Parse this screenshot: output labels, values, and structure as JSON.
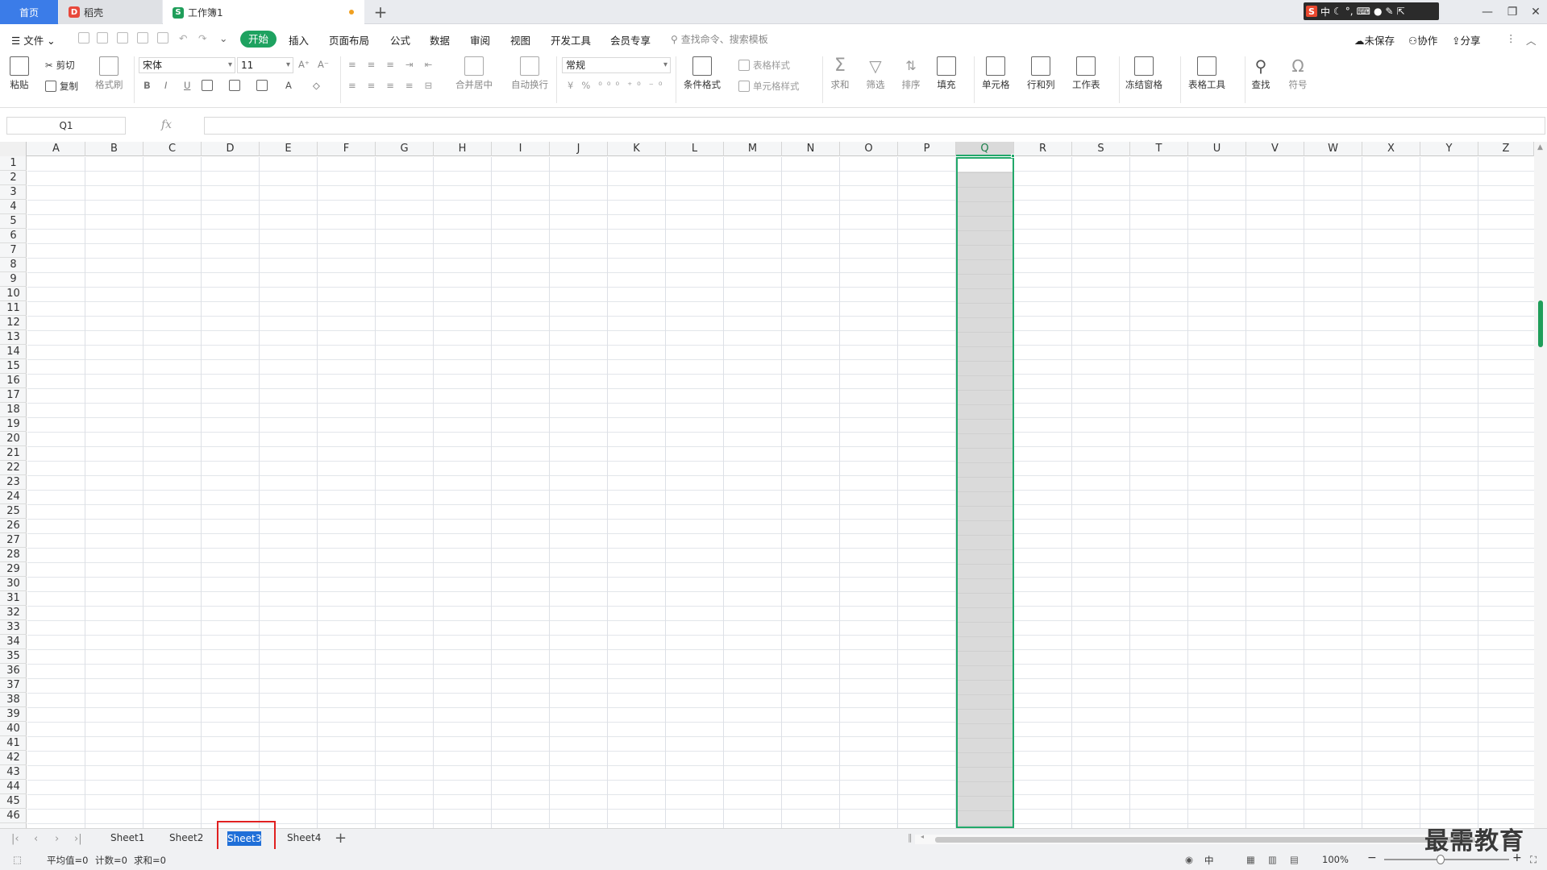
{
  "tabs": {
    "home": "首页",
    "daoke": "稻壳",
    "workbook": "工作簿1",
    "new_tab": "+"
  },
  "ime": {
    "label": "中"
  },
  "window": {
    "minimize": "—",
    "restore": "❐",
    "close": "✕"
  },
  "menu": {
    "file": "文件",
    "items": [
      "开始",
      "插入",
      "页面布局",
      "公式",
      "数据",
      "审阅",
      "视图",
      "开发工具",
      "会员专享"
    ],
    "search_placeholder": "查找命令、搜索模板",
    "unsaved": "未保存",
    "collab": "协作",
    "share": "分享"
  },
  "ribbon": {
    "paste": "粘贴",
    "cut": "剪切",
    "copy": "复制",
    "format_painter": "格式刷",
    "font_name": "宋体",
    "font_size": "11",
    "merge_center": "合并居中",
    "auto_wrap": "自动换行",
    "number_format": "常规",
    "cond_format": "条件格式",
    "table_style": "表格样式",
    "cell_style": "单元格样式",
    "sum": "求和",
    "filter": "筛选",
    "sort": "排序",
    "fill": "填充",
    "cell": "单元格",
    "row_col": "行和列",
    "worksheet": "工作表",
    "freeze": "冻结窗格",
    "table_tools": "表格工具",
    "find": "查找",
    "symbol": "符号"
  },
  "formula": {
    "name_box": "Q1",
    "fx": "fx",
    "value": ""
  },
  "grid": {
    "columns": [
      "A",
      "B",
      "C",
      "D",
      "E",
      "F",
      "G",
      "H",
      "I",
      "J",
      "K",
      "L",
      "M",
      "N",
      "O",
      "P",
      "Q",
      "R",
      "S",
      "T",
      "U",
      "V",
      "W",
      "X",
      "Y",
      "Z"
    ],
    "selected_column": "Q",
    "rows": [
      "1",
      "2",
      "3",
      "4",
      "5",
      "6",
      "7",
      "8",
      "9",
      "10",
      "11",
      "12",
      "13",
      "14",
      "15",
      "16",
      "17",
      "18",
      "19",
      "20",
      "21",
      "22",
      "23",
      "24",
      "25",
      "26",
      "27",
      "28",
      "29",
      "30",
      "31",
      "32",
      "33",
      "34",
      "35",
      "36",
      "37",
      "38",
      "39",
      "40",
      "41",
      "42",
      "43",
      "44",
      "45",
      "46"
    ]
  },
  "sheets": {
    "s1": "Sheet1",
    "s2": "Sheet2",
    "s3": "Sheet3",
    "s4": "Sheet4",
    "add": "+"
  },
  "status": {
    "average": "平均值=0",
    "count": "计数=0",
    "sum": "求和=0",
    "zoom": "100%",
    "minus": "−",
    "plus": "+"
  },
  "watermark": "最需教育",
  "colors": {
    "accent": "#1ea260",
    "selection": "#22a86a",
    "sheet_tab_active": "#1f6fd8",
    "annotation": "#e02020"
  }
}
